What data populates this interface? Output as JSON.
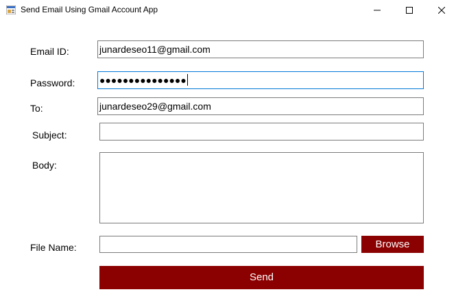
{
  "window": {
    "title": "Send Email Using Gmail Account App"
  },
  "form": {
    "email_id_label": "Email ID:",
    "email_id_value": "junardeseo11@gmail.com",
    "password_label": "Password:",
    "password_masked": "●●●●●●●●●●●●●●●",
    "to_label": "To:",
    "to_value": "junardeseo29@gmail.com",
    "subject_label": "Subject:",
    "subject_value": "",
    "body_label": "Body:",
    "body_value": "",
    "file_name_label": "File Name:",
    "file_name_value": "",
    "browse_label": "Browse",
    "send_label": "Send"
  },
  "colors": {
    "button_bg": "#8b0000",
    "focus_border": "#0078d7"
  },
  "icons": [
    "app-icon",
    "minimize-icon",
    "maximize-icon",
    "close-icon"
  ]
}
